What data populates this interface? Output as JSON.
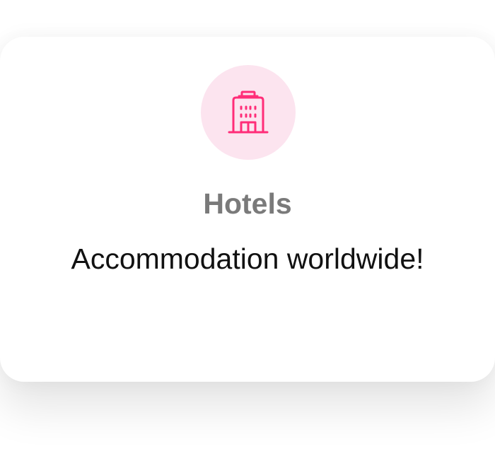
{
  "card": {
    "icon": "hotel-building-icon",
    "title": "Hotels",
    "description": "Accommodation worldwide!"
  },
  "colors": {
    "accent": "#ff2d78",
    "icon_background": "#fce4ef",
    "title_text": "#7a7a7a",
    "description_text": "#111111",
    "card_background": "#ffffff"
  }
}
